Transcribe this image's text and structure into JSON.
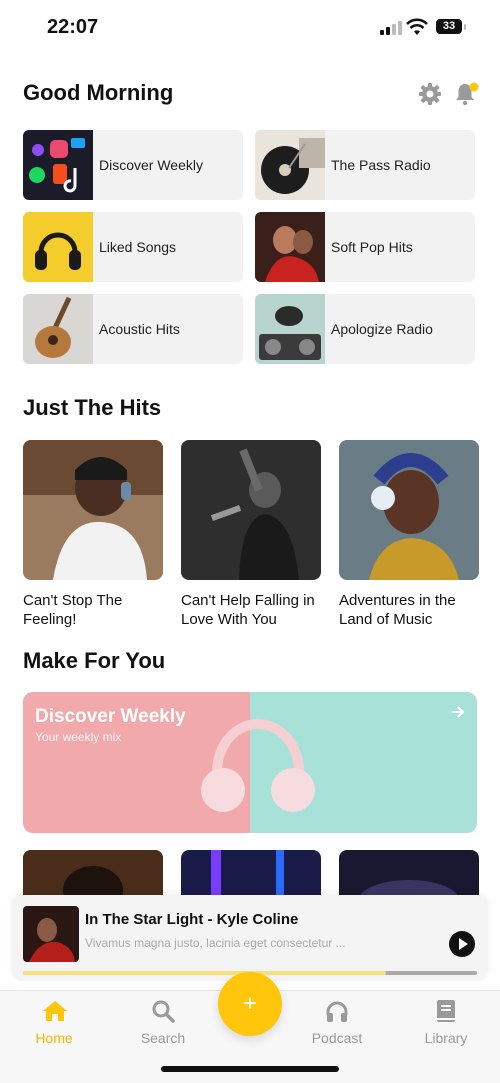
{
  "status": {
    "time": "22:07",
    "battery": "33"
  },
  "header": {
    "greeting": "Good Morning"
  },
  "quick_tiles": [
    {
      "label": "Discover Weekly"
    },
    {
      "label": "The Pass Radio"
    },
    {
      "label": "Liked Songs"
    },
    {
      "label": "Soft Pop Hits"
    },
    {
      "label": "Acoustic Hits"
    },
    {
      "label": "Apologize Radio"
    }
  ],
  "hits": {
    "title": "Just The Hits",
    "items": [
      {
        "label": "Can't Stop The Feeling!"
      },
      {
        "label": "Can't Help Falling in Love With You"
      },
      {
        "label": "Adventures in the Land of Music"
      }
    ]
  },
  "made": {
    "title": "Make For You",
    "banner": {
      "title": "Discover Weekly",
      "subtitle": "Your weekly mix"
    }
  },
  "player": {
    "title": "In The Star Light - Kyle Coline",
    "subtitle": "Vivamus magna justo, lacinia eget consectetur ...",
    "progress": 0.8
  },
  "tabs": [
    {
      "label": "Home"
    },
    {
      "label": "Search"
    },
    {
      "label": "Podcast"
    },
    {
      "label": "Library"
    }
  ],
  "fab": {
    "label": "+"
  },
  "colors": {
    "accent": "#ffc60b",
    "tab_active": "#f5b800"
  }
}
